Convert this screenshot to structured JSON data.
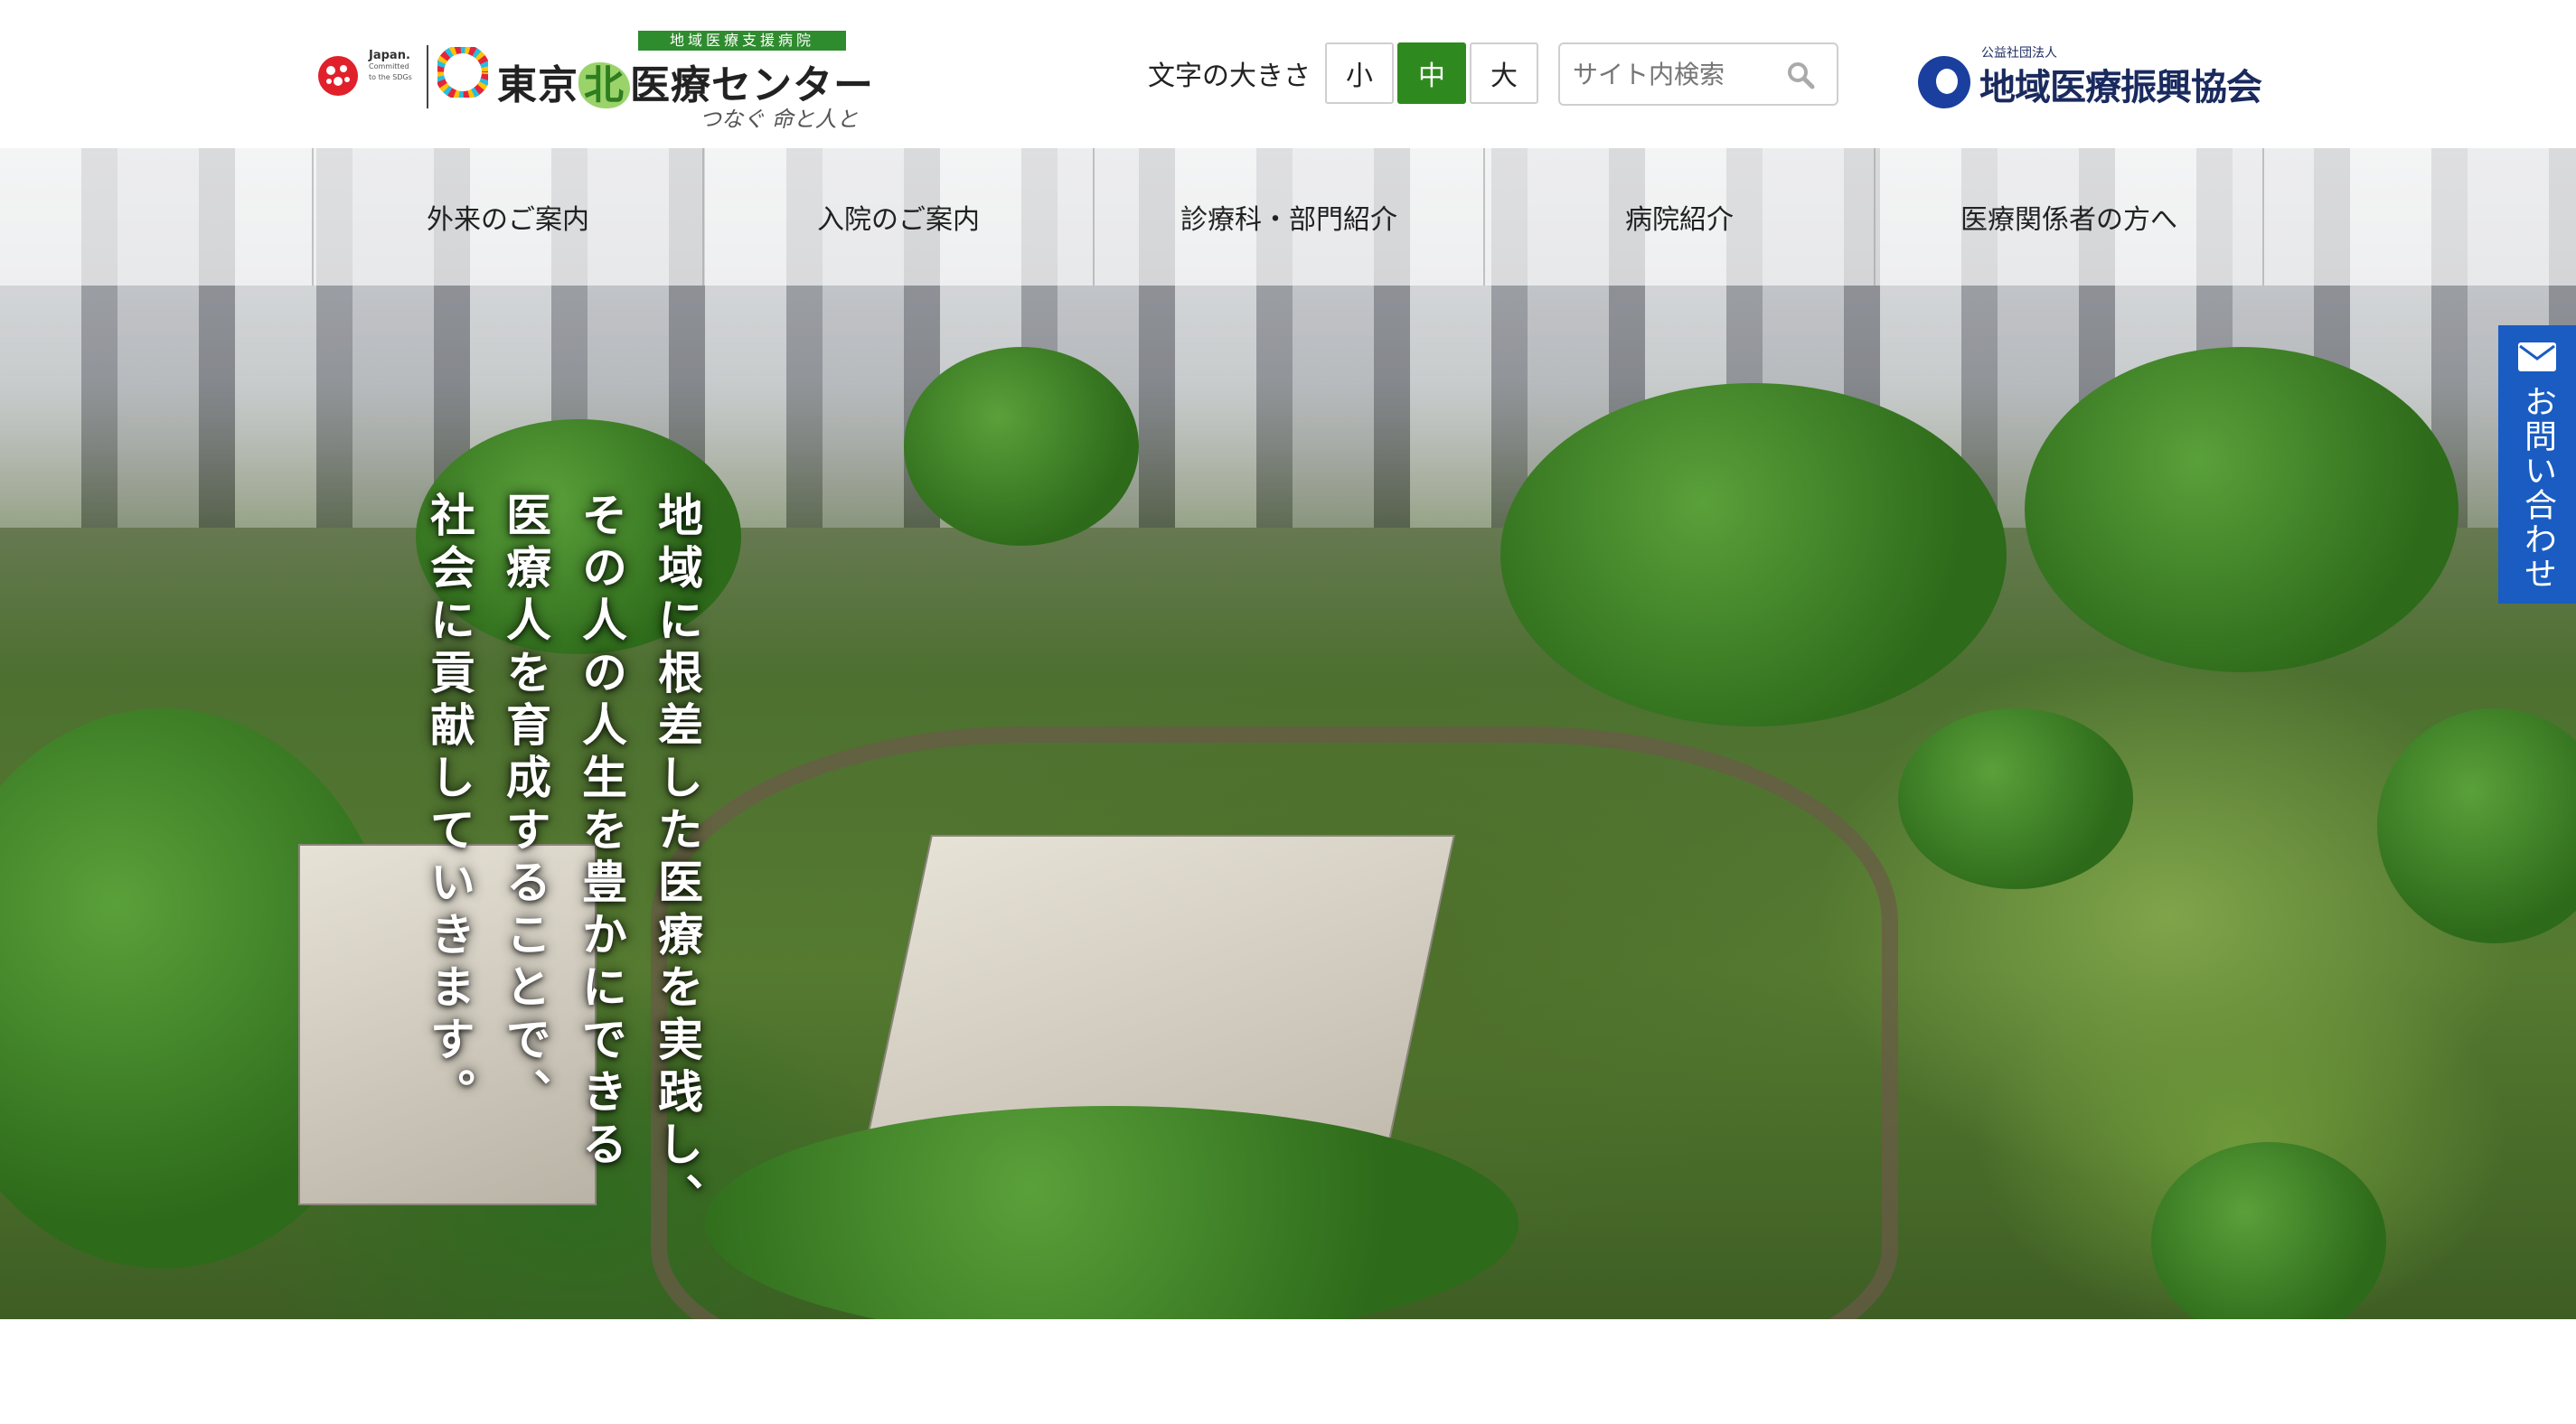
{
  "header": {
    "japan_mark": {
      "line1": "Japan.",
      "line2": "Committed",
      "line3": "to the SDGs"
    },
    "logo": {
      "tag": "地域医療支援病院",
      "name_a": "東京",
      "name_kita": "北",
      "name_b": "医療センター",
      "tagline": "つなぐ 命と人と"
    },
    "font_size": {
      "label": "文字の大きさ",
      "small": "小",
      "medium": "中",
      "large": "大",
      "selected": "中"
    },
    "search": {
      "placeholder": "サイト内検索",
      "icon": "search-icon"
    },
    "association": {
      "small": "公益社団法人",
      "name": "地域医療振興協会"
    }
  },
  "nav": {
    "items": [
      {
        "label": "外来のご案内"
      },
      {
        "label": "入院のご案内"
      },
      {
        "label": "診療科・部門紹介"
      },
      {
        "label": "病院紹介"
      },
      {
        "label": "医療関係者の方へ"
      }
    ]
  },
  "hero": {
    "copy": [
      "地域に根差した医療を実践し、",
      "その人の人生を豊かにできる",
      "医療人を育成することで、",
      "社会に貢献していきます。"
    ]
  },
  "contact": {
    "label": "お問い合わせ",
    "icon": "mail-icon"
  },
  "colors": {
    "accent_green": "#2e8a1e",
    "contact_blue": "#1a5cc2",
    "assoc_navy": "#1a2a5e"
  }
}
